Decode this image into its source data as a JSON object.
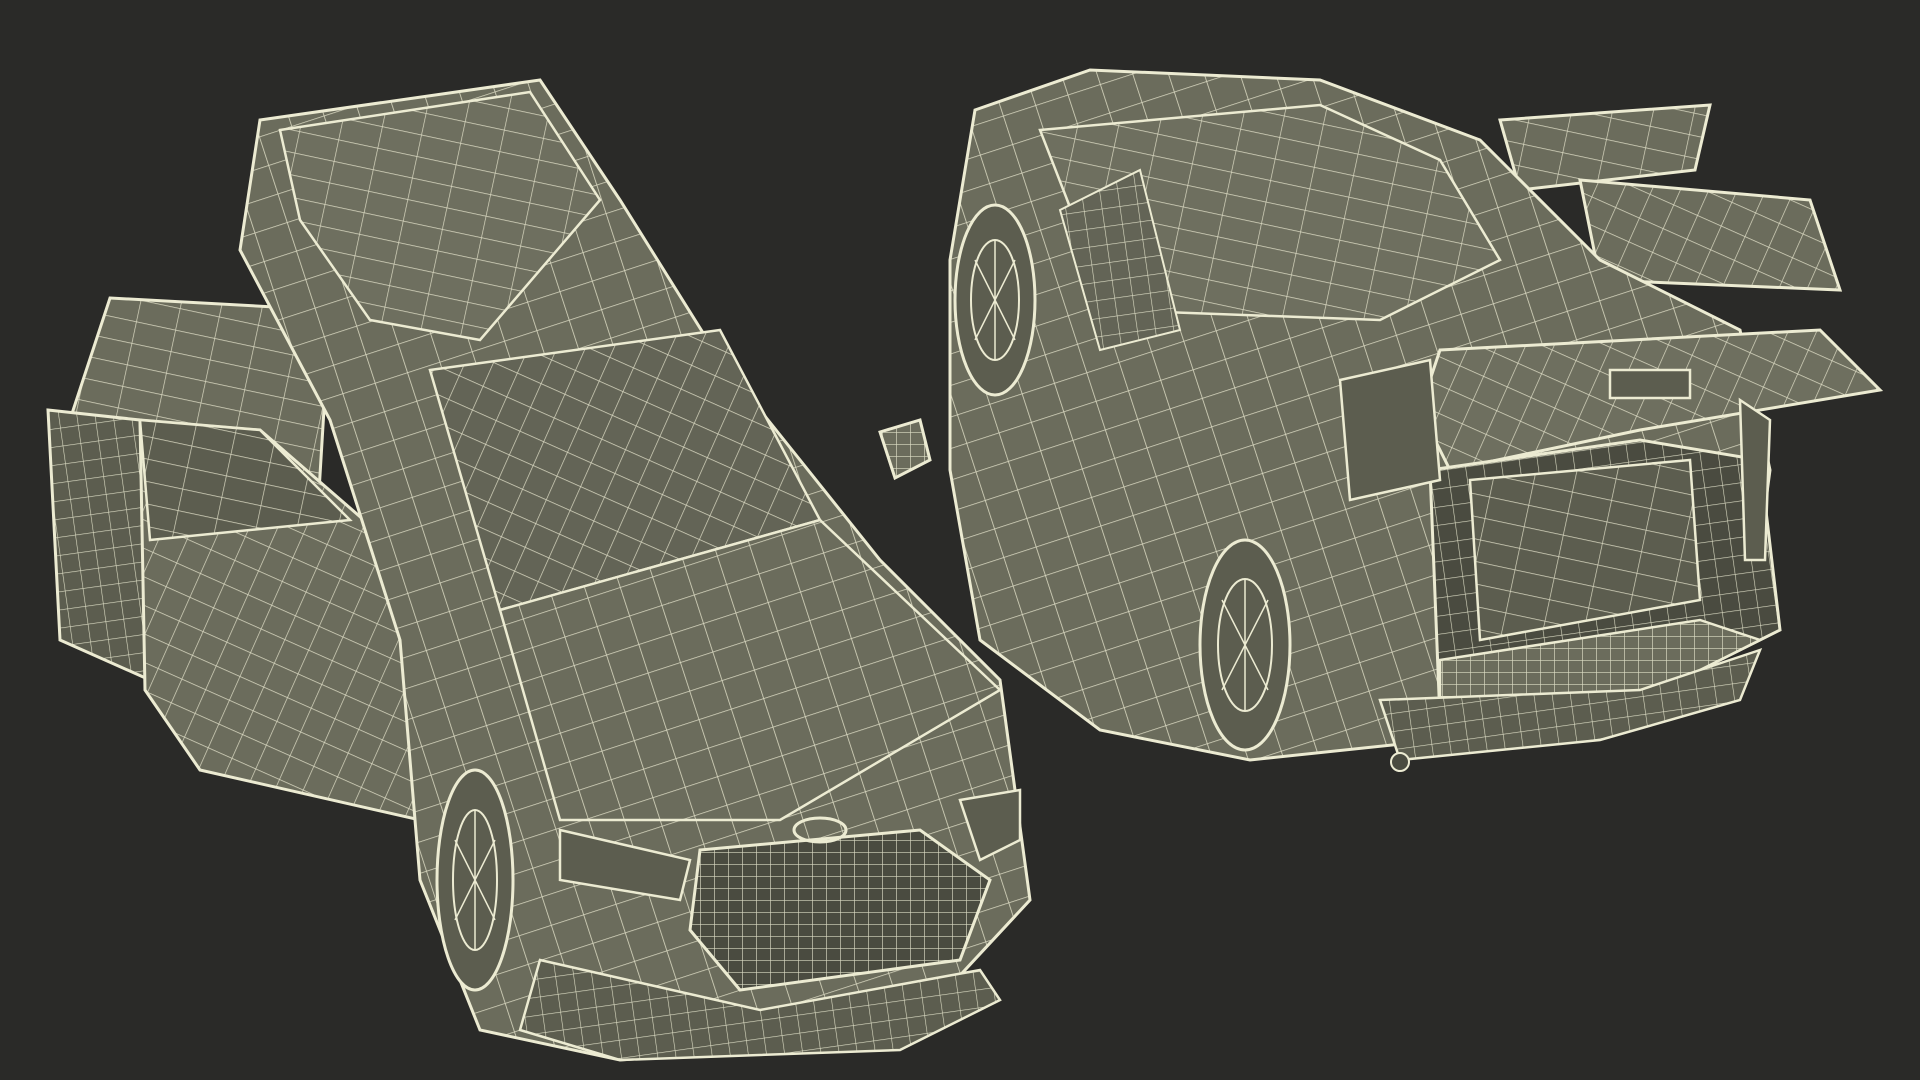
{
  "scene": {
    "background": "#2a2a28",
    "body_color": "#6b6c5c",
    "body_shade": "#5c5d4f",
    "body_dark": "#4a4b40",
    "wire_color": "#ecebd2",
    "objects": [
      {
        "name": "suv-front-view",
        "description_visible": false
      },
      {
        "name": "suv-rear-view",
        "description_visible": false
      }
    ]
  }
}
